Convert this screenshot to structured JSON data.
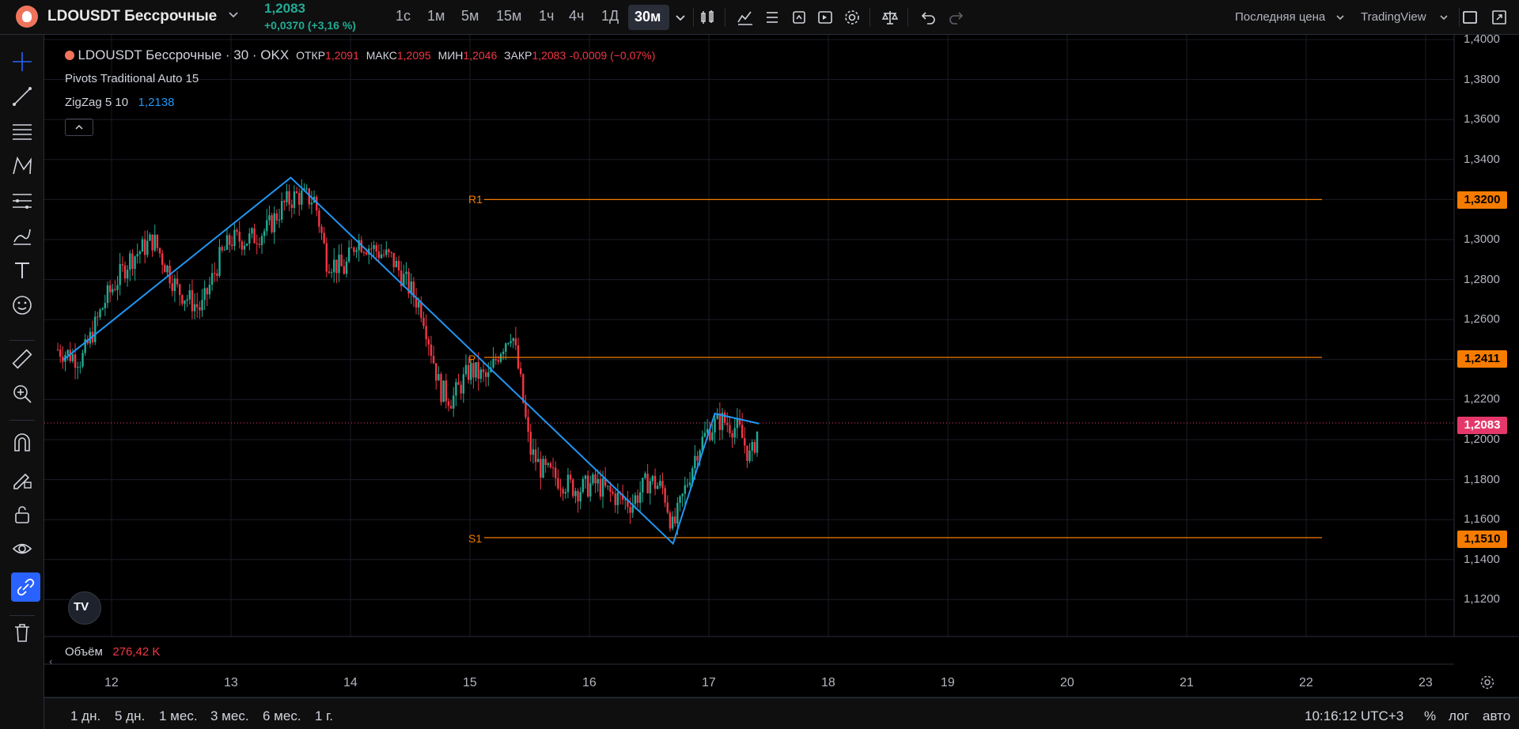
{
  "header": {
    "symbol": "LDOUSDT Бессрочные",
    "price": "1,2083",
    "change": "+0,0370 (+3,16 %)",
    "timeframes": [
      "1с",
      "1м",
      "5м",
      "15м",
      "1ч",
      "4ч",
      "1Д"
    ],
    "active_timeframe": "30м",
    "price_type": "Последняя цена",
    "theme": "TradingView"
  },
  "legend": {
    "title": "LDOUSDT Бессрочные · 30 · OKX",
    "open_label": "ОТКР",
    "open": "1,2091",
    "high_label": "МАКС",
    "high": "1,2095",
    "low_label": "МИН",
    "low": "1,2046",
    "close_label": "ЗАКР",
    "close": "1,2083",
    "chg": "-0,0009 (−0,07%)",
    "pivots": "Pivots Traditional Auto 15",
    "zigzag": "ZigZag 5 10",
    "zigzag_value": "1,2138"
  },
  "pivot_labels": {
    "r1": "R1",
    "p": "P",
    "s1": "S1"
  },
  "volume": {
    "label": "Объём",
    "value": "276,42 K"
  },
  "bottom": {
    "ranges": [
      "1 дн.",
      "5 дн.",
      "1 мес.",
      "3 мес.",
      "6 мес.",
      "1 г."
    ],
    "clock": "10:16:12 UTC+3",
    "percent": "%",
    "log": "лог",
    "auto": "авто"
  },
  "colors": {
    "up": "#22ab94",
    "down": "#f23645",
    "zigzag": "#2196f3",
    "pivot": "#f57c00",
    "last_price": "#e5386a"
  },
  "chart_data": {
    "type": "candlestick",
    "x_ticks": [
      "12",
      "13",
      "14",
      "15",
      "16",
      "17",
      "18",
      "19",
      "20",
      "21",
      "22",
      "23"
    ],
    "y_ticks": [
      "1,4000",
      "1,3800",
      "1,3600",
      "1,3400",
      "1,3200",
      "1,3000",
      "1,2800",
      "1,2600",
      "1,2400",
      "1,2200",
      "1,2000",
      "1,1800",
      "1,1600",
      "1,1400",
      "1,1200"
    ],
    "ylim": [
      1.105,
      1.405
    ],
    "pivots": {
      "R1": 1.32,
      "P": 1.2411,
      "S1": 1.151
    },
    "pivot_tags": [
      "1,3200",
      "1,2411",
      "1,1510"
    ],
    "last_price": 1.2083,
    "last_price_tag": "1,2083",
    "zigzag": [
      [
        11.6,
        1.24
      ],
      [
        13.5,
        1.331
      ],
      [
        16.7,
        1.148
      ],
      [
        17.05,
        1.213
      ],
      [
        17.42,
        1.208
      ]
    ],
    "price_path": [
      [
        11.55,
        1.245
      ],
      [
        11.75,
        1.24
      ],
      [
        11.95,
        1.27
      ],
      [
        12.15,
        1.29
      ],
      [
        12.35,
        1.3
      ],
      [
        12.55,
        1.275
      ],
      [
        12.75,
        1.265
      ],
      [
        12.9,
        1.29
      ],
      [
        13.0,
        1.3
      ],
      [
        13.15,
        1.3
      ],
      [
        13.3,
        1.305
      ],
      [
        13.45,
        1.318
      ],
      [
        13.55,
        1.322
      ],
      [
        13.7,
        1.32
      ],
      [
        13.8,
        1.29
      ],
      [
        13.95,
        1.285
      ],
      [
        14.05,
        1.3
      ],
      [
        14.2,
        1.295
      ],
      [
        14.35,
        1.29
      ],
      [
        14.5,
        1.275
      ],
      [
        14.6,
        1.265
      ],
      [
        14.75,
        1.225
      ],
      [
        14.85,
        1.22
      ],
      [
        15.0,
        1.235
      ],
      [
        15.15,
        1.23
      ],
      [
        15.25,
        1.245
      ],
      [
        15.35,
        1.255
      ],
      [
        15.42,
        1.23
      ],
      [
        15.5,
        1.195
      ],
      [
        15.6,
        1.185
      ],
      [
        15.75,
        1.18
      ],
      [
        15.9,
        1.175
      ],
      [
        16.05,
        1.178
      ],
      [
        16.2,
        1.172
      ],
      [
        16.35,
        1.168
      ],
      [
        16.5,
        1.18
      ],
      [
        16.62,
        1.175
      ],
      [
        16.7,
        1.155
      ],
      [
        16.8,
        1.175
      ],
      [
        16.9,
        1.195
      ],
      [
        17.0,
        1.205
      ],
      [
        17.1,
        1.21
      ],
      [
        17.25,
        1.205
      ],
      [
        17.35,
        1.19
      ],
      [
        17.42,
        1.208
      ]
    ]
  }
}
